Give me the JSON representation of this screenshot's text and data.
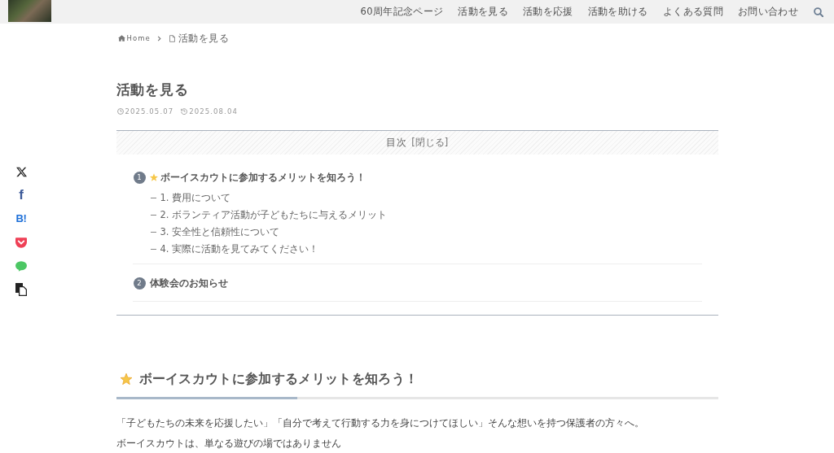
{
  "header": {
    "nav": [
      {
        "label": "60周年記念ページ"
      },
      {
        "label": "活動を見る"
      },
      {
        "label": "活動を応援"
      },
      {
        "label": "活動を助ける"
      },
      {
        "label": "よくある質問"
      },
      {
        "label": "お問い合わせ"
      }
    ]
  },
  "share_buttons": [
    {
      "kind": "x"
    },
    {
      "kind": "facebook",
      "glyph": "f"
    },
    {
      "kind": "hatena",
      "glyph": "B!"
    },
    {
      "kind": "pocket"
    },
    {
      "kind": "line"
    },
    {
      "kind": "copy"
    }
  ],
  "breadcrumb": [
    {
      "kind": "home",
      "label": "Home"
    },
    {
      "kind": "page",
      "label": "活動を見る"
    }
  ],
  "title": "活動を見る",
  "dates": [
    {
      "kind": "published",
      "date": "2025.05.07"
    },
    {
      "kind": "updated",
      "date": "2025.08.04"
    }
  ],
  "toc": {
    "title": "目次",
    "toggle": "[閉じる]",
    "items": [
      {
        "number": "1",
        "label": "ボーイスカウトに参加するメリットを知ろう！",
        "has_icon": true,
        "children": [
          {
            "label": "1. 費用について"
          },
          {
            "label": "2. ボランティア活動が子どもたちに与えるメリット"
          },
          {
            "label": "3. 安全性と信頼性について"
          },
          {
            "label": "4. 実際に活動を見てみてください！"
          }
        ]
      },
      {
        "number": "2",
        "label": "体験会のお知らせ",
        "has_icon": false
      }
    ]
  },
  "section": {
    "heading": "ボーイスカウトに参加するメリットを知ろう！",
    "has_icon": true,
    "paragraphs": [
      "「子どもたちの未来を応援したい」「自分で考えて行動する力を身につけてほしい」そんな想いを持つ保護者の方々へ。",
      "ボーイスカウトは、単なる遊びの場ではありません"
    ]
  }
}
